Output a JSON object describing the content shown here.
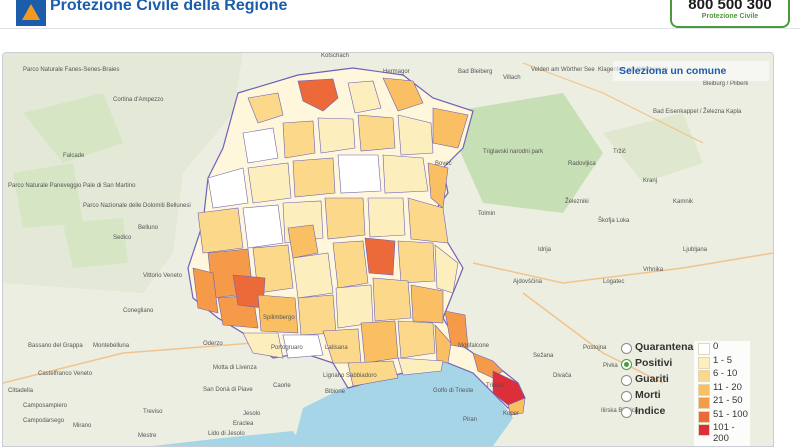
{
  "header": {
    "title": "Protezione Civile della Regione",
    "phone_number": "800 500 300",
    "phone_subtitle": "Protezione Civile"
  },
  "map": {
    "select_label": "Seleziona un comune",
    "towns": [
      {
        "name": "Kotschach"
      },
      {
        "name": "Hermagor"
      },
      {
        "name": "Bad Bleiberg"
      },
      {
        "name": "Villach"
      },
      {
        "name": "Velden am Wörther See"
      },
      {
        "name": "Klagenfurt am Wörthersee"
      },
      {
        "name": "Bleiburg / Pliberk"
      },
      {
        "name": "Bad Eisenkappel / Železna Kapla"
      },
      {
        "name": "Tržič"
      },
      {
        "name": "Radovljica"
      },
      {
        "name": "Triglavski narodni park"
      },
      {
        "name": "Bovec"
      },
      {
        "name": "Kranj"
      },
      {
        "name": "Kamnik"
      },
      {
        "name": "Železniki"
      },
      {
        "name": "Škofja Loka"
      },
      {
        "name": "Tolmin"
      },
      {
        "name": "Ljubljana"
      },
      {
        "name": "Idrija"
      },
      {
        "name": "Logatec"
      },
      {
        "name": "Vrhnika"
      },
      {
        "name": "Ajdovščina"
      },
      {
        "name": "Postojna"
      },
      {
        "name": "Cortina d'Ampezzo"
      },
      {
        "name": "Parco Naturale Fanes-Senes-Braies"
      },
      {
        "name": "Parco Naturale Paneveggio Pale di San Martino"
      },
      {
        "name": "Parco Nazionale delle Dolomiti Bellunesi"
      },
      {
        "name": "Falcade"
      },
      {
        "name": "Belluno"
      },
      {
        "name": "Sedico"
      },
      {
        "name": "Vittorio Veneto"
      },
      {
        "name": "Conegliano"
      },
      {
        "name": "Montebelluna"
      },
      {
        "name": "Bassano del Grappa"
      },
      {
        "name": "Castelfranco Veneto"
      },
      {
        "name": "Treviso"
      },
      {
        "name": "Oderzo"
      },
      {
        "name": "San Donà di Piave"
      },
      {
        "name": "Jesolo"
      },
      {
        "name": "Portogruaro"
      },
      {
        "name": "Latisana"
      },
      {
        "name": "Lignano Sabbiadoro"
      },
      {
        "name": "Caorle"
      },
      {
        "name": "Bibione"
      },
      {
        "name": "Monfalcone"
      },
      {
        "name": "Golfo di Trieste"
      },
      {
        "name": "Trieste"
      },
      {
        "name": "Koper"
      },
      {
        "name": "Piran"
      },
      {
        "name": "Sežana"
      },
      {
        "name": "Divača"
      },
      {
        "name": "Ilirska Bistrica"
      },
      {
        "name": "Pivka"
      },
      {
        "name": "Camposampiero"
      },
      {
        "name": "Mirano"
      },
      {
        "name": "Mestre"
      },
      {
        "name": "Cittadella"
      },
      {
        "name": "Campodarsego"
      },
      {
        "name": "Lido di Jesolo"
      },
      {
        "name": "Eraclea"
      },
      {
        "name": "Motta di Livenza"
      },
      {
        "name": "Spilimbergo"
      }
    ]
  },
  "layers": [
    {
      "label": "Quarantena",
      "selected": false
    },
    {
      "label": "Positivi",
      "selected": true
    },
    {
      "label": "Guariti",
      "selected": false
    },
    {
      "label": "Morti",
      "selected": false
    },
    {
      "label": "Indice",
      "selected": false
    }
  ],
  "legend": [
    {
      "label": "0",
      "color": "#ffffff"
    },
    {
      "label": "1 - 5",
      "color": "#fdeebe"
    },
    {
      "label": "6 - 10",
      "color": "#fcd98a"
    },
    {
      "label": "11 - 20",
      "color": "#f9bf62"
    },
    {
      "label": "21 - 50",
      "color": "#f59a49"
    },
    {
      "label": "51 - 100",
      "color": "#ec6a3a"
    },
    {
      "label": "101 - 200",
      "color": "#dc2f3a"
    }
  ],
  "colors": {
    "brand_blue": "#1b5cab",
    "brand_orange": "#f39a1e",
    "brand_green": "#4c9a3c",
    "region_border": "#6e62b5",
    "sea": "#a7d5e8"
  }
}
